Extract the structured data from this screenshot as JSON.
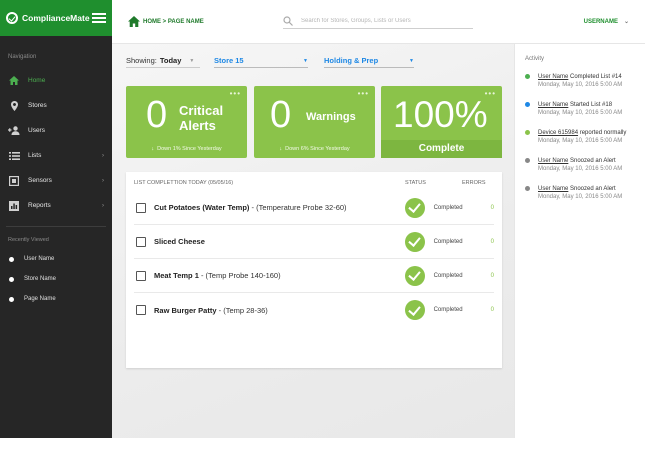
{
  "brand": {
    "name": "ComplianceMate"
  },
  "nav": {
    "heading": "Navigation",
    "items": [
      {
        "label": "Home",
        "icon": "home-icon",
        "active": true,
        "chevron": ""
      },
      {
        "label": "Stores",
        "icon": "location-pin-icon",
        "chevron": ""
      },
      {
        "label": "Users",
        "icon": "add-user-icon",
        "chevron": ""
      },
      {
        "label": "Lists",
        "icon": "list-icon",
        "chevron": "›"
      },
      {
        "label": "Sensors",
        "icon": "sensor-icon",
        "chevron": "›"
      },
      {
        "label": "Reports",
        "icon": "bar-chart-icon",
        "chevron": "›"
      }
    ],
    "recent_heading": "Recently Viewed",
    "recent": [
      {
        "label": "User Name"
      },
      {
        "label": "Store Name"
      },
      {
        "label": "Page Name"
      }
    ]
  },
  "header": {
    "breadcrumb": "HOME > PAGE NAME",
    "search_placeholder": "Search for Stores, Groups, Lists or Users",
    "username": "USERNAME",
    "caret": "⌄"
  },
  "filters": {
    "showing_label": "Showing:",
    "showing_value": "Today",
    "store": "Store 15",
    "area": "Holding & Prep"
  },
  "cards": [
    {
      "value": "0",
      "label_line1": "Critical",
      "label_line2": "Alerts",
      "sub": "Down 1% Since Yesterday",
      "color": "#8bc34a"
    },
    {
      "value": "0",
      "label_line1": "Warnings",
      "sub": "Down 6% Since Yesterday",
      "color": "#8bc34a"
    },
    {
      "value": "100%",
      "label_line1": "Complete",
      "color": "#8bc34a"
    }
  ],
  "list": {
    "title": "LIST COMPLETTION TODAY (05/05/16)",
    "status_header": "STATUS",
    "errors_header": "ERRORS",
    "rows": [
      {
        "name": "Cut Potatoes (Water Temp)",
        "detail": " - (Temperature Probe 32-60)",
        "status": "Completed",
        "errors": "0"
      },
      {
        "name": "Sliced Cheese",
        "detail": "",
        "status": "Completed",
        "errors": "0"
      },
      {
        "name": "Meat Temp 1",
        "detail": " - (Temp Probe 140-160)",
        "status": "Completed",
        "errors": "0"
      },
      {
        "name": "Raw Burger Patty",
        "detail": " - (Temp 28-36)",
        "status": "Completed",
        "errors": "0"
      }
    ]
  },
  "activity": {
    "heading": "Activity",
    "items": [
      {
        "link": "User Name",
        "text": " Completed List #14",
        "time": "Monday, May 10, 2016  5:00 AM",
        "color": "#4caf50"
      },
      {
        "link": "User Name",
        "text": " Started List #18",
        "time": "Monday, May 10, 2016  5:00 AM",
        "color": "#1e88e5"
      },
      {
        "link": "Device 615984",
        "text": " reported normally",
        "time": "Monday, May 10, 2016  5:00 AM",
        "color": "#8bc34a"
      },
      {
        "link": "User Name",
        "text": " Snoozed an Alert",
        "time": "Monday, May 10, 2016  5:00 AM",
        "color": "#888888"
      },
      {
        "link": "User Name",
        "text": " Snoozed an Alert",
        "time": "Monday, May 10, 2016  5:00 AM",
        "color": "#888888"
      }
    ]
  }
}
